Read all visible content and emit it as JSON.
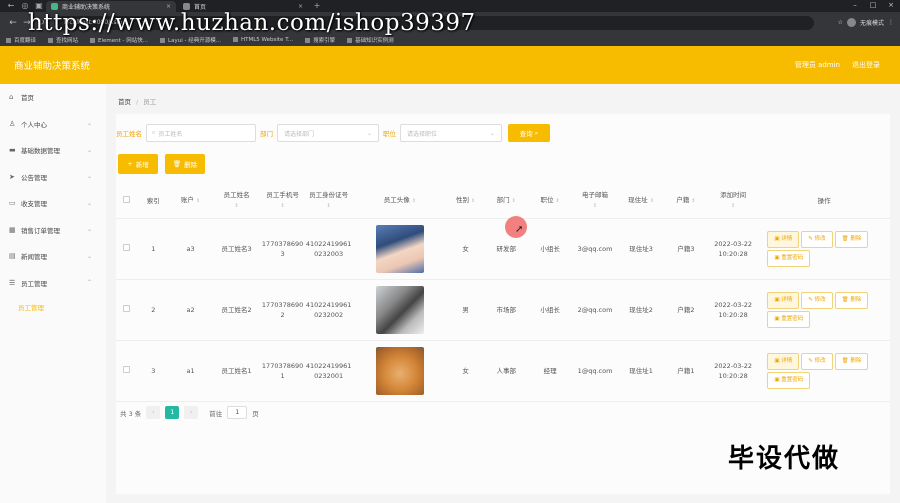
{
  "browser": {
    "tabs": [
      {
        "label": "商业辅助决策系统",
        "active": true
      },
      {
        "label": "首页",
        "active": false
      }
    ],
    "url": "localhost:8080/ssm...",
    "profile_label": "无痕模式",
    "bookmarks": [
      "百度翻译",
      "查找网站",
      "Element - 网站快...",
      "Layui - 经典开源模...",
      "HTML5 Website T...",
      "搜索引擎",
      "基础知识实例测"
    ]
  },
  "watermark_url": "https://www.huzhan.com/ishop39397",
  "watermark_cn": "毕设代做",
  "header": {
    "title": "商业辅助决策系统",
    "user_label": "管理员 admin",
    "logout_label": "退出登录"
  },
  "sidebar": {
    "items": [
      {
        "label": "首页",
        "icon": "home-icon",
        "has_children": false
      },
      {
        "label": "个人中心",
        "icon": "user-icon",
        "has_children": true
      },
      {
        "label": "基础数据管理",
        "icon": "data-icon",
        "has_children": true
      },
      {
        "label": "公告管理",
        "icon": "send-icon",
        "has_children": true
      },
      {
        "label": "收支管理",
        "icon": "wallet-icon",
        "has_children": true
      },
      {
        "label": "销售订单管理",
        "icon": "grid-icon",
        "has_children": true
      },
      {
        "label": "新闻管理",
        "icon": "news-icon",
        "has_children": true
      },
      {
        "label": "员工管理",
        "icon": "list-icon",
        "has_children": true
      }
    ],
    "active_sub": "员工管理"
  },
  "breadcrumb": {
    "home": "首页",
    "sep": "/",
    "current": "员工"
  },
  "filters": {
    "name_label": "员工姓名",
    "name_placeholder": "员工姓名",
    "dept_label": "部门",
    "dept_placeholder": "请选择部门",
    "pos_label": "职位",
    "pos_placeholder": "请选择职位",
    "query_label": "查询"
  },
  "actions": {
    "add_label": "新增",
    "delete_label": "删除"
  },
  "table": {
    "headers": [
      "索引",
      "账户",
      "员工姓名",
      "员工手机号",
      "员工身份证号",
      "员工头像",
      "性别",
      "部门",
      "职位",
      "电子邮箱",
      "现住址",
      "户籍",
      "添加时间",
      "操作"
    ],
    "rows": [
      {
        "index": "1",
        "account": "a3",
        "name": "员工姓名3",
        "phone": "17703786903",
        "idcard": "410224199610232003",
        "photo": "p1",
        "gender": "女",
        "dept": "研发部",
        "position": "小组长",
        "email": "3@qq.com",
        "address": "现住址3",
        "huji": "户籍3",
        "time": "2022-03-22 10:20:28"
      },
      {
        "index": "2",
        "account": "a2",
        "name": "员工姓名2",
        "phone": "17703786902",
        "idcard": "410224199610232002",
        "photo": "p2",
        "gender": "男",
        "dept": "市场部",
        "position": "小组长",
        "email": "2@qq.com",
        "address": "现住址2",
        "huji": "户籍2",
        "time": "2022-03-22 10:20:28"
      },
      {
        "index": "3",
        "account": "a1",
        "name": "员工姓名1",
        "phone": "17703786901",
        "idcard": "410224199610232001",
        "photo": "p3",
        "gender": "女",
        "dept": "人事部",
        "position": "经理",
        "email": "1@qq.com",
        "address": "现住址1",
        "huji": "户籍1",
        "time": "2022-03-22 10:20:28"
      }
    ],
    "op_labels": {
      "detail": "详情",
      "edit": "修改",
      "delete": "删除",
      "reset": "重置密码"
    }
  },
  "pager": {
    "total": "共 3 条",
    "current": "1",
    "goto": "前往",
    "page_value": "1",
    "page_unit": "页"
  },
  "colors": {
    "accent": "#f7bc00",
    "pager_active": "#22b8a2"
  }
}
